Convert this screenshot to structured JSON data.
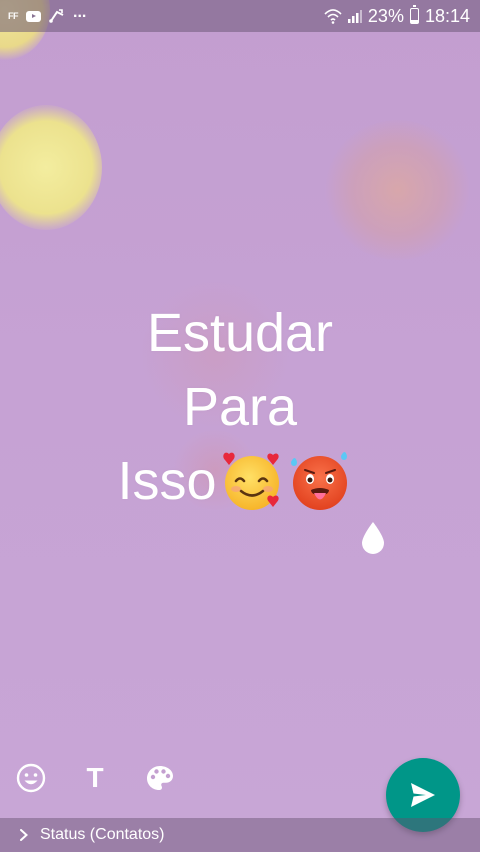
{
  "status_bar": {
    "left_icons": [
      "ff-icon",
      "youtube-icon",
      "usb-icon"
    ],
    "ff_label": "FF",
    "more_label": "...",
    "battery": "23%",
    "time": "18:14"
  },
  "status_text": {
    "line1": "Estudar",
    "line2": "Para",
    "line3": "Isso"
  },
  "emojis": [
    "smiling-face-with-hearts-emoji",
    "hot-face-emoji"
  ],
  "tools": {
    "emoji": "emoji-icon",
    "text_label": "T",
    "palette": "palette-icon"
  },
  "send": {
    "icon": "send-icon"
  },
  "footer": {
    "label": "Status (Contatos)"
  },
  "colors": {
    "background": "#c4a0d0",
    "fab": "#009688"
  }
}
